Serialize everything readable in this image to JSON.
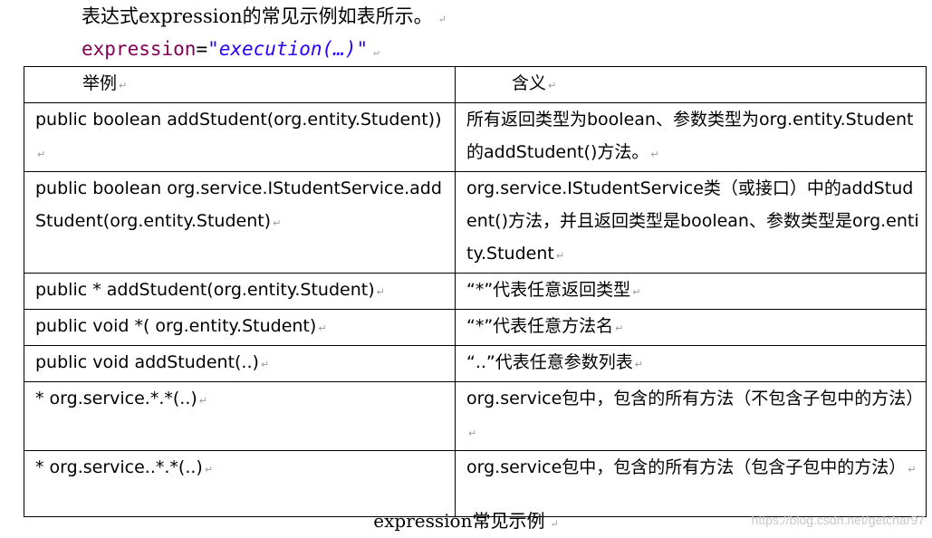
{
  "intro_text": "表达式expression的常见示例如表所示。",
  "expression_line": {
    "keyword": "expression",
    "equals": "=",
    "value": "\"execution(…)\""
  },
  "table": {
    "headers": [
      "举例",
      "含义"
    ],
    "rows": [
      {
        "example": "public boolean addStudent(org.entity.Student))",
        "meaning": "所有返回类型为boolean、参数类型为org.entity.Student的addStudent()方法。"
      },
      {
        "example": "public boolean org.service.IStudentService.addStudent(org.entity.Student)",
        "meaning": "org.service.IStudentService类（或接口）中的addStudent()方法，并且返回类型是boolean、参数类型是org.entity.Student"
      },
      {
        "example": "public * addStudent(org.entity.Student)",
        "meaning": "“*”代表任意返回类型"
      },
      {
        "example": "public void *( org.entity.Student)",
        "meaning": "“*”代表任意方法名"
      },
      {
        "example": "public void addStudent(..)",
        "meaning": "“..”代表任意参数列表"
      },
      {
        "example": "* org.service.*.*(..)",
        "meaning": "org.service包中，包含的所有方法（不包含子包中的方法）"
      },
      {
        "example": "* org.service..*.*(..)",
        "meaning": "org.service包中，包含的所有方法（包含子包中的方法）"
      }
    ]
  },
  "caption": "expression常见示例",
  "watermark": "https://blog.csdn.net/getchar97",
  "colors": {
    "keyword": "#7f0055",
    "string": "#2a00ff",
    "watermark": "#c8c8c8"
  }
}
